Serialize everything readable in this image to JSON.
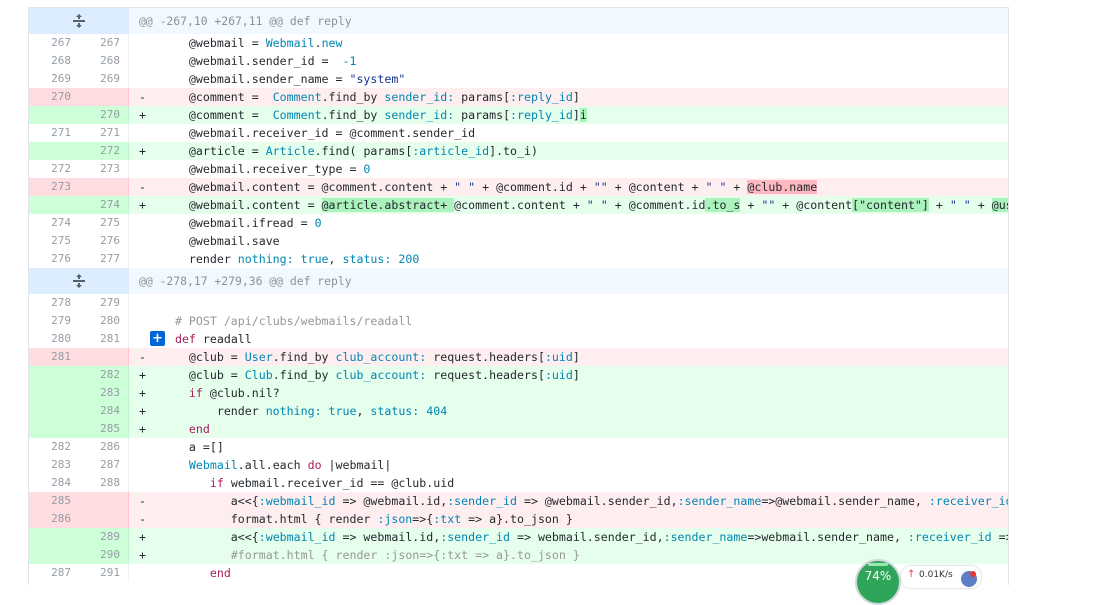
{
  "hunks": [
    {
      "header": "@@ -267,10 +267,11 @@ def reply",
      "lines": [
        {
          "type": "ctx",
          "old": "267",
          "new": "267",
          "sign": "",
          "html": "    @webmail = <span class=\"c\">Webmail</span>.<span class=\"c\">new</span>"
        },
        {
          "type": "ctx",
          "old": "268",
          "new": "268",
          "sign": "",
          "html": "    @webmail.sender_id =  <span class=\"c\">-1</span>"
        },
        {
          "type": "ctx",
          "old": "269",
          "new": "269",
          "sign": "",
          "html": "    @webmail.sender_name = <span class=\"s\">\"system\"</span>"
        },
        {
          "type": "del",
          "old": "270",
          "new": "",
          "sign": "-",
          "html": "    @comment =  <span class=\"c\">Comment</span>.find_by <span class=\"sym\">sender_id:</span> params[<span class=\"sym\">:reply_id</span>]"
        },
        {
          "type": "add",
          "old": "",
          "new": "270",
          "sign": "+",
          "html": "    @comment =  <span class=\"c\">Comment</span>.find_by <span class=\"sym\">sender_id:</span> params[<span class=\"sym\">:reply_id</span>]<span class=\"hl-add\">i</span>"
        },
        {
          "type": "ctx",
          "old": "271",
          "new": "271",
          "sign": "",
          "html": "    @webmail.receiver_id = @comment.sender_id"
        },
        {
          "type": "add",
          "old": "",
          "new": "272",
          "sign": "+",
          "html": "    @article = <span class=\"c\">Article</span>.find( params[<span class=\"sym\">:article_id</span>].to_i)"
        },
        {
          "type": "ctx",
          "old": "272",
          "new": "273",
          "sign": "",
          "html": "    @webmail.receiver_type = <span class=\"c\">0</span>"
        },
        {
          "type": "del",
          "old": "273",
          "new": "",
          "sign": "-",
          "html": "    @webmail.content = @comment.content + <span class=\"s\">\" \"</span> + @comment.id + <span class=\"s\">\"\"</span> + @content + <span class=\"s\">\" \"</span> + <span class=\"hl-del\">@club.name</span>"
        },
        {
          "type": "add",
          "old": "",
          "new": "274",
          "sign": "+",
          "html": "    @webmail.content = <span class=\"hl-add\">@article.abstract+ </span>@comment.content + <span class=\"s\">\" \"</span> + @comment.id<span class=\"hl-add\">.to_s</span> + <span class=\"s\">\"\"</span> + @content<span class=\"hl-add\">[\"content\"]</span> + <span class=\"s\">\" \"</span> + <span class=\"hl-add\">@use</span>"
        },
        {
          "type": "ctx",
          "old": "274",
          "new": "275",
          "sign": "",
          "html": "    @webmail.ifread = <span class=\"c\">0</span>"
        },
        {
          "type": "ctx",
          "old": "275",
          "new": "276",
          "sign": "",
          "html": "    @webmail.save"
        },
        {
          "type": "ctx",
          "old": "276",
          "new": "277",
          "sign": "",
          "html": "    render <span class=\"sym\">nothing:</span> <span class=\"c\">true</span>, <span class=\"sym\">status:</span> <span class=\"c\">200</span>"
        }
      ]
    },
    {
      "header": "@@ -278,17 +279,36 @@ def reply",
      "lines": [
        {
          "type": "ctx",
          "old": "278",
          "new": "279",
          "sign": "",
          "html": ""
        },
        {
          "type": "ctx",
          "old": "279",
          "new": "280",
          "sign": "",
          "html": "  <span class=\"cm\"># POST /api/clubs/webmails/readall</span>"
        },
        {
          "type": "ctx",
          "old": "280",
          "new": "281",
          "sign": "",
          "html": "  <span class=\"k\">def</span> readall",
          "comment_btn": true
        },
        {
          "type": "del",
          "old": "281",
          "new": "",
          "sign": "-",
          "html": "    @club = <span class=\"c\">User</span>.find_by <span class=\"sym\">club_account:</span> request.headers[<span class=\"sym\">:uid</span>]"
        },
        {
          "type": "add",
          "old": "",
          "new": "282",
          "sign": "+",
          "html": "    @club = <span class=\"c\">Club</span>.find_by <span class=\"sym\">club_account:</span> request.headers[<span class=\"sym\">:uid</span>]"
        },
        {
          "type": "add",
          "old": "",
          "new": "283",
          "sign": "+",
          "html": "    <span class=\"k\">if</span> @club.nil?"
        },
        {
          "type": "add",
          "old": "",
          "new": "284",
          "sign": "+",
          "html": "        render <span class=\"sym\">nothing:</span> <span class=\"c\">true</span>, <span class=\"sym\">status:</span> <span class=\"c\">404</span>"
        },
        {
          "type": "add",
          "old": "",
          "new": "285",
          "sign": "+",
          "html": "    <span class=\"k\">end</span>"
        },
        {
          "type": "ctx",
          "old": "282",
          "new": "286",
          "sign": "",
          "html": "    a =[]"
        },
        {
          "type": "ctx",
          "old": "283",
          "new": "287",
          "sign": "",
          "html": "    <span class=\"c\">Webmail</span>.all.each <span class=\"k\">do</span> |webmail|"
        },
        {
          "type": "ctx",
          "old": "284",
          "new": "288",
          "sign": "",
          "html": "       <span class=\"k\">if</span> webmail.receiver_id == @club.uid"
        },
        {
          "type": "del",
          "old": "285",
          "new": "",
          "sign": "-",
          "html": "          a&lt;&lt;{<span class=\"sym\">:webmail_id</span> =&gt; @webmail.id,<span class=\"sym\">:sender_id</span> =&gt; @webmail.sender_id,<span class=\"sym\">:sender_name</span>=&gt;@webmail.sender_name, <span class=\"sym\">:receiver_id</span> ="
        },
        {
          "type": "del",
          "old": "286",
          "new": "",
          "sign": "-",
          "html": "          format.html { render <span class=\"sym\">:json</span>=&gt;{<span class=\"sym\">:txt</span> =&gt; a}.to_json }"
        },
        {
          "type": "add",
          "old": "",
          "new": "289",
          "sign": "+",
          "html": "          a&lt;&lt;{<span class=\"sym\">:webmail_id</span> =&gt; webmail.id,<span class=\"sym\">:sender_id</span> =&gt; webmail.sender_id,<span class=\"sym\">:sender_name</span>=&gt;webmail.sender_name, <span class=\"sym\">:receiver_id</span> =&gt; w"
        },
        {
          "type": "add",
          "old": "",
          "new": "290",
          "sign": "+",
          "html": "          <span class=\"cm\">#format.html { render :json=&gt;{:txt =&gt; a}.to_json }</span>"
        },
        {
          "type": "ctx",
          "old": "287",
          "new": "291",
          "sign": "",
          "html": "       <span class=\"k\">end</span>"
        }
      ]
    }
  ],
  "expand_icon": "unfold-icon",
  "add_comment_label": "+",
  "widget": {
    "gauge_label": "74%",
    "upload_arrow": "↑",
    "speed": "0.01K/s"
  }
}
